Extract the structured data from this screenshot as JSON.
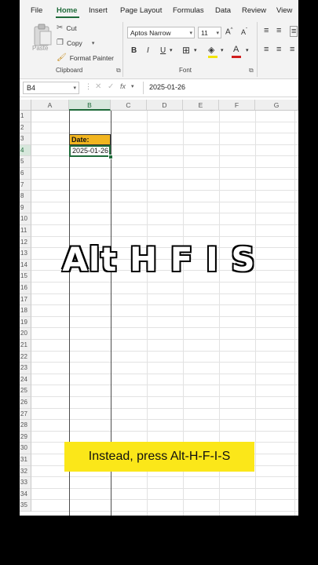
{
  "ribbon": {
    "tabs": [
      "File",
      "Home",
      "Insert",
      "Page Layout",
      "Formulas",
      "Data",
      "Review",
      "View"
    ],
    "active_tab": "Home",
    "clipboard": {
      "paste_label": "Paste",
      "cut_label": "Cut",
      "copy_label": "Copy",
      "format_painter_label": "Format Painter",
      "group_label": "Clipboard"
    },
    "font": {
      "family": "Aptos Narrow",
      "size": "11",
      "bold": "B",
      "italic": "I",
      "underline": "U",
      "font_color_glyph": "A",
      "group_label": "Font"
    }
  },
  "formula_bar": {
    "name_box": "B4",
    "fx": "fx",
    "content": "2025-01-26"
  },
  "grid": {
    "columns": [
      "A",
      "B",
      "C",
      "D",
      "E",
      "F",
      "G"
    ],
    "selected_column": "B",
    "rows": [
      "1",
      "2",
      "3",
      "4",
      "5",
      "6",
      "7",
      "8",
      "9",
      "10",
      "11",
      "12",
      "13",
      "14",
      "15",
      "16",
      "17",
      "18",
      "19",
      "20",
      "21",
      "22",
      "23",
      "24",
      "25",
      "26",
      "27",
      "28",
      "29",
      "30",
      "31",
      "32",
      "33",
      "34",
      "35"
    ],
    "selected_row": "4",
    "cells": {
      "b3": "Date:",
      "b4": "2025-01-26"
    }
  },
  "overlay": {
    "big_caption": "Alt H F I S",
    "subtitle": "Instead, press Alt-H-F-I-S"
  },
  "colors": {
    "accent_green": "#1f6b3a",
    "header_fill": "#f2b51f",
    "subtitle_bg": "#fbe719"
  }
}
